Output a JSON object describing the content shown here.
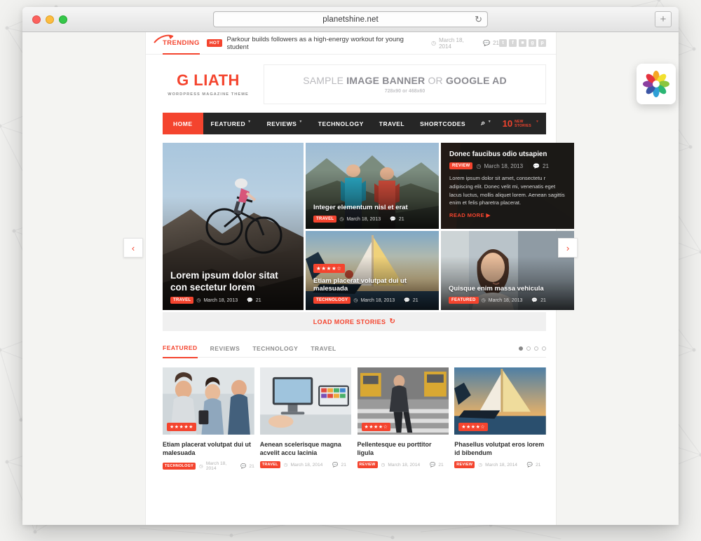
{
  "browser": {
    "url": "planetshine.net",
    "reload_icon": "reload-icon",
    "new_tab_label": "+",
    "traffic_lights": [
      "close",
      "minimize",
      "zoom"
    ]
  },
  "desktop": {
    "app_icon_name": "photos-app-icon"
  },
  "site": {
    "trending": {
      "label": "TRENDING",
      "badge": "HOT",
      "headline": "Parkour builds followers as a high-energy workout for young student",
      "date": "March 18, 2014",
      "comments": "21",
      "socials": [
        {
          "name": "twitter-icon",
          "glyph": "t"
        },
        {
          "name": "facebook-icon",
          "glyph": "f"
        },
        {
          "name": "flickr-icon",
          "glyph": "■"
        },
        {
          "name": "googleplus-icon",
          "glyph": "g"
        },
        {
          "name": "pinterest-icon",
          "glyph": "p"
        }
      ]
    },
    "logo": {
      "text": "G LIATH",
      "tagline": "WORDPRESS MAGAZINE THEME"
    },
    "banner": {
      "line1_a": "SAMPLE ",
      "line1_b": "IMAGE BANNER",
      "line1_c": " OR ",
      "line1_d": "GOOGLE AD",
      "line2": "728x90 or 468x60"
    },
    "nav": {
      "items": [
        {
          "label": "HOME",
          "active": true,
          "caret": false
        },
        {
          "label": "FEATURED",
          "active": false,
          "caret": true
        },
        {
          "label": "REVIEWS",
          "active": false,
          "caret": true
        },
        {
          "label": "TECHNOLOGY",
          "active": false,
          "caret": false
        },
        {
          "label": "TRAVEL",
          "active": false,
          "caret": false
        },
        {
          "label": "SHORTCODES",
          "active": false,
          "caret": false
        },
        {
          "label": "⌕",
          "active": false,
          "caret": true
        }
      ],
      "stories_count": "10",
      "stories_line1": "NEW",
      "stories_line2": "STORIES"
    },
    "hero": {
      "big": {
        "title": "Lorem ipsum dolor sitat con sectetur lorem",
        "tag": "TRAVEL",
        "date": "March 18, 2013",
        "comments": "21"
      },
      "top_mid": {
        "title": "Integer elementum nisl et erat",
        "tag": "TRAVEL",
        "date": "March 18, 2013",
        "comments": "21"
      },
      "text_card": {
        "title": "Donec faucibus odio utsapien",
        "tag": "REVIEW",
        "date": "March 18, 2013",
        "comments": "21",
        "excerpt": "Lorem ipsum dolor sit amet, consectetu r adipiscing elit. Donec velit mi, venenatis eget lacus luctus, mollis aliquet lorem. Aenean sagittis enim et felis pharetra placerat.",
        "read_more": "READ MORE"
      },
      "bot_mid": {
        "title": "Etiam placerat volutpat dui ut malesuada",
        "tag": "TECHNOLOGY",
        "date": "March 18, 2013",
        "comments": "21",
        "stars": "★★★★☆"
      },
      "bot_right": {
        "title": "Quisque enim massa vehicula",
        "tag": "FEATURED",
        "date": "March 18, 2013",
        "comments": "21"
      }
    },
    "load_more": "LOAD MORE STORIES",
    "tabs": [
      {
        "label": "FEATURED",
        "active": true
      },
      {
        "label": "REVIEWS",
        "active": false
      },
      {
        "label": "TECHNOLOGY",
        "active": false
      },
      {
        "label": "TRAVEL",
        "active": false
      }
    ],
    "pagination_dots": 4,
    "pagination_active_index": 0,
    "cards": [
      {
        "title": "Etiam placerat volutpat dui ut malesuada",
        "tag": "TECHNOLOGY",
        "date": "March 18, 2014",
        "comments": "21",
        "stars": "★★★★★"
      },
      {
        "title": "Aenean scelerisque magna acvelit accu lacinia",
        "tag": "TRAVEL",
        "date": "March 18, 2014",
        "comments": "21",
        "stars": ""
      },
      {
        "title": "Pellentesque eu porttitor ligula",
        "tag": "REVIEW",
        "date": "March 18, 2014",
        "comments": "21",
        "stars": "★★★★☆"
      },
      {
        "title": "Phasellus volutpat eros lorem id bibendum",
        "tag": "REVIEW",
        "date": "March 18, 2014",
        "comments": "21",
        "stars": "★★★★☆"
      }
    ],
    "carousel": {
      "prev_label": "‹",
      "next_label": "›"
    }
  },
  "colors": {
    "accent": "#f4442e",
    "nav_bg": "#262626",
    "page_bg": "#f2f2f0"
  }
}
